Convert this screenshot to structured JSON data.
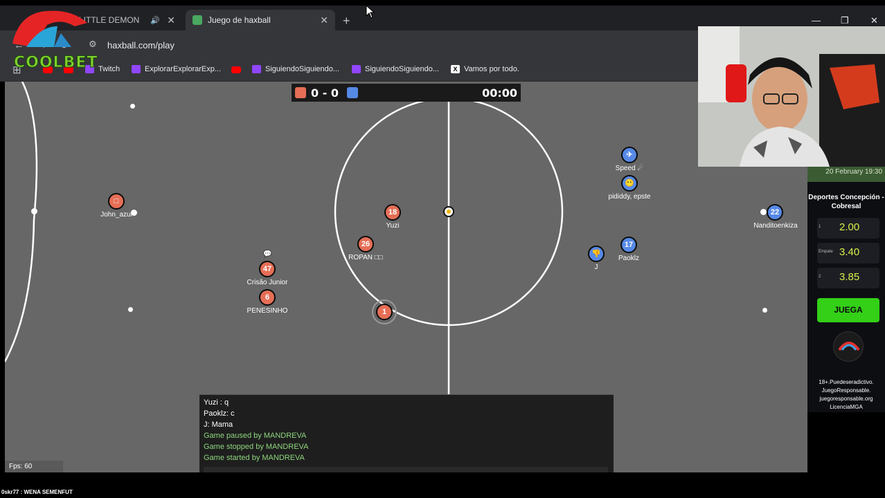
{
  "browser": {
    "tabs": [
      {
        "title": "LITTLE DEMON",
        "favicon_color": "#ff0000",
        "active": false
      },
      {
        "title": "Juego de haxball",
        "favicon_color": "#4aa860",
        "active": true
      }
    ],
    "url": "haxball.com/play",
    "bookmarks": [
      {
        "label": "Twitch",
        "icon": "twitch-icon",
        "color": "#9146ff"
      },
      {
        "label": "ExplorarExplorarExp...",
        "icon": "twitch-icon",
        "color": "#9146ff"
      },
      {
        "label": "SiguiendoSiguiendo...",
        "icon": "twitch-icon",
        "color": "#9146ff"
      },
      {
        "label": "SiguiendoSiguiendo...",
        "icon": "twitch-icon",
        "color": "#9146ff"
      },
      {
        "label": "Vamos por todo.",
        "icon": "x-icon",
        "color": "#000000"
      }
    ]
  },
  "scoreboard": {
    "score": "0 - 0",
    "time": "00:00",
    "red_color": "#e56e56",
    "blue_color": "#5689e5"
  },
  "players": [
    {
      "avatar": "18",
      "name": "Yuzi",
      "team": "red"
    },
    {
      "avatar": "26",
      "name": "ROPAN □□",
      "team": "red"
    },
    {
      "avatar": "47",
      "name": "Crisão Junior",
      "team": "red"
    },
    {
      "avatar": "6",
      "name": "PENESINHO",
      "team": "red"
    },
    {
      "avatar": "1",
      "name": "",
      "team": "red"
    },
    {
      "avatar": "□",
      "name": "John_azul",
      "team": "red"
    },
    {
      "avatar": "✈",
      "name": "Speed ☄",
      "team": "blue"
    },
    {
      "avatar": "😶",
      "name": "pididdy, epste",
      "team": "blue"
    },
    {
      "avatar": "17",
      "name": "Paoklz",
      "team": "blue"
    },
    {
      "avatar": "👎",
      "name": "J",
      "team": "blue"
    },
    {
      "avatar": "22",
      "name": "Nanditoenkiza",
      "team": "blue"
    }
  ],
  "chat": [
    {
      "text": "Yuzi : q",
      "kind": "usr"
    },
    {
      "text": "Paoklz: c",
      "kind": "usr"
    },
    {
      "text": "J: Mama",
      "kind": "usr"
    },
    {
      "text": "Game paused by MANDREVA",
      "kind": "sys"
    },
    {
      "text": "Game stopped by MANDREVA",
      "kind": "sys"
    },
    {
      "text": "Game started by MANDREVA",
      "kind": "sys"
    }
  ],
  "fps": "Fps: 60",
  "overlay": {
    "brand": "COOLBET",
    "ad_date": "20 February 19:30",
    "match": "Deportes Concepción - Cobresal",
    "odds": [
      {
        "label": "1",
        "value": "2.00"
      },
      {
        "label": "Empate",
        "value": "3.40"
      },
      {
        "label": "2",
        "value": "3.85"
      }
    ],
    "cta": "JUEGA",
    "legal": [
      "18+.Puedeseradictivo.",
      "JuegoResponsable.",
      "juegoresponsable.org",
      "LicenciaMGA"
    ],
    "ticker": "0skr77 : WENA SEMENFUT"
  }
}
